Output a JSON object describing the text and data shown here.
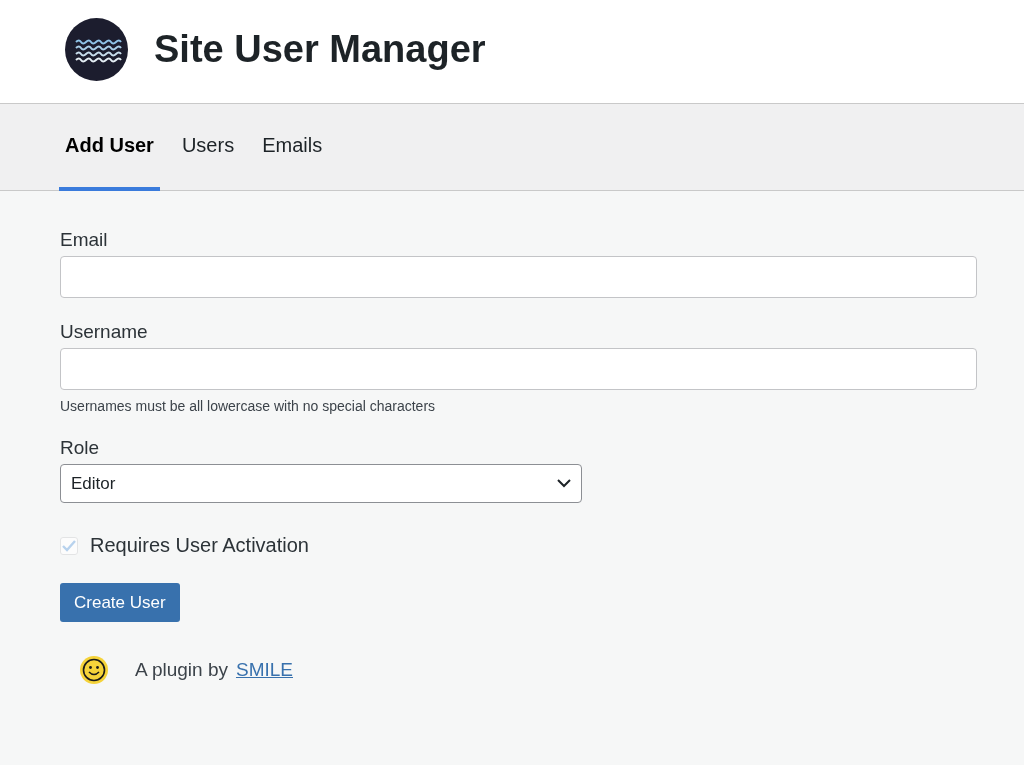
{
  "header": {
    "title": "Site User Manager"
  },
  "tabs": [
    {
      "label": "Add User",
      "selected": true
    },
    {
      "label": "Users",
      "selected": false
    },
    {
      "label": "Emails",
      "selected": false
    }
  ],
  "form": {
    "fields": [
      {
        "kind": "text",
        "label": "Email"
      },
      {
        "kind": "text",
        "label": "Username",
        "help": "Usernames must be all lowercase with no special characters"
      },
      {
        "kind": "select",
        "label": "Role",
        "value": "Editor"
      }
    ],
    "checkbox": {
      "label": "Requires User Activation",
      "checked": true,
      "disabled": true
    },
    "submit": "Create User"
  },
  "footer": {
    "text": "A plugin by",
    "link": "SMILE"
  }
}
